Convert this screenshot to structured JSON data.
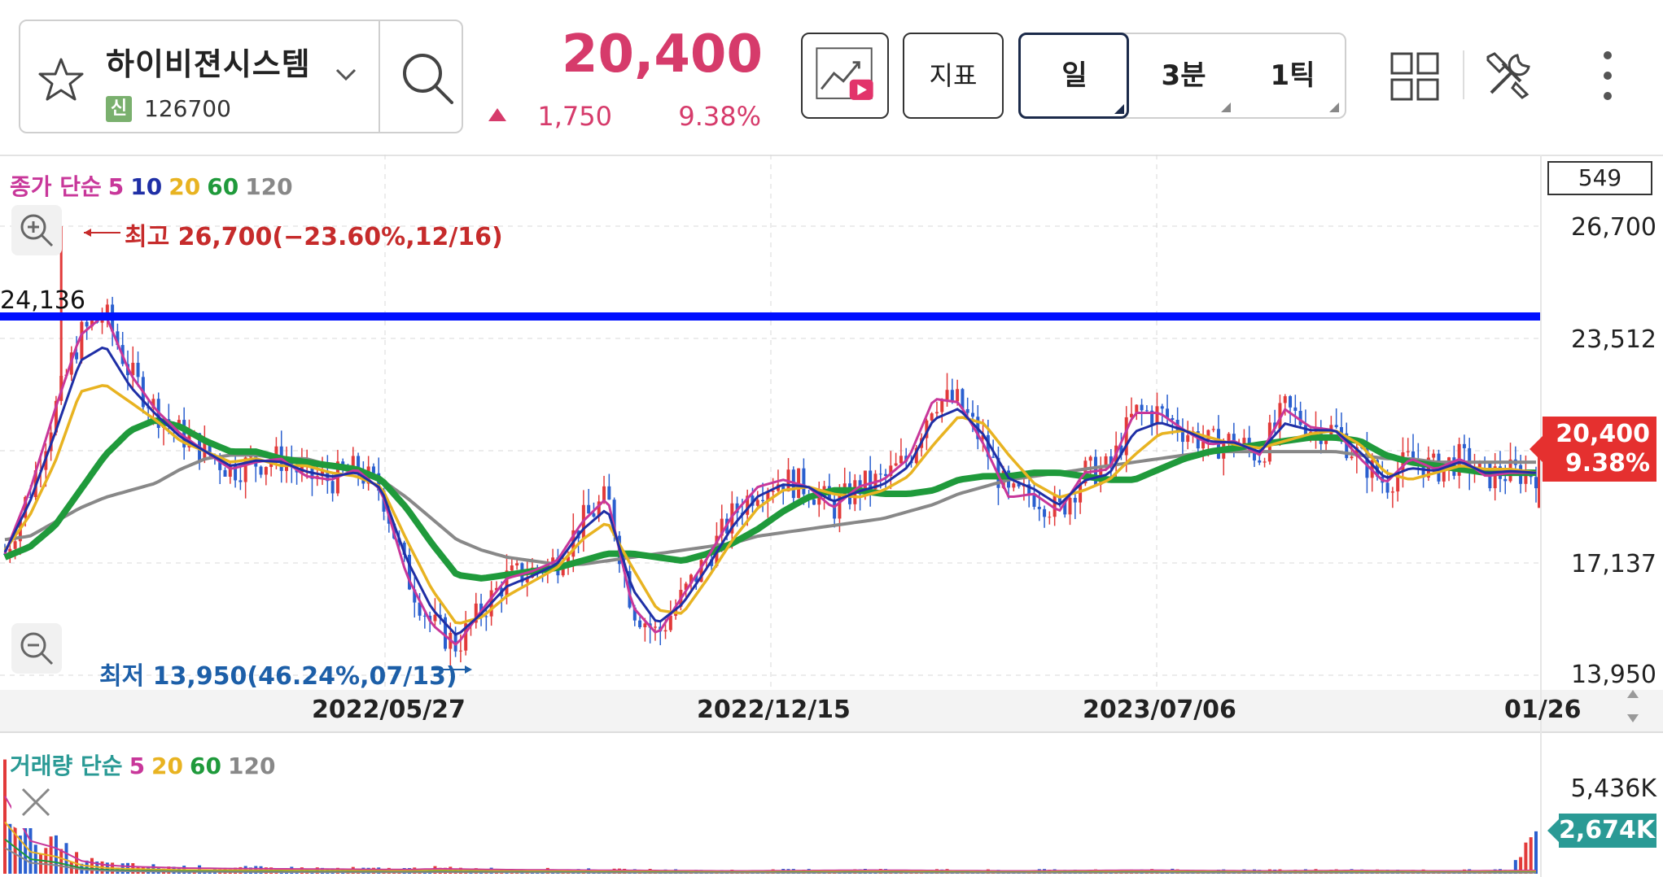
{
  "header": {
    "stock_name": "하이비젼시스템",
    "market_badge": "신",
    "stock_code": "126700",
    "price": "20,400",
    "change": "1,750",
    "change_pct": "9.38%",
    "indicator_button": "지표",
    "periods": [
      "일",
      "3분",
      "1틱"
    ],
    "selected_period": "일",
    "icons": [
      "star-icon",
      "chevron-down-icon",
      "search-icon",
      "chart-video-icon",
      "grid-layout-icon",
      "tools-icon",
      "more-vertical-icon"
    ],
    "colors": {
      "up": "#d63b6b"
    }
  },
  "price_panel": {
    "legend_prefix": "종가 단순",
    "ma_periods": [
      "5",
      "10",
      "20",
      "60",
      "120"
    ],
    "ma_colors": [
      "#c8379a",
      "#1f2fa6",
      "#e8b321",
      "#1f9a3b",
      "#888888"
    ],
    "count_badge": "549",
    "high_annotation": "최고 26,700(−23.60%,12/16)",
    "low_annotation": "최저 13,950(46.24%,07/13)",
    "hline_label": "24,136",
    "hline_color": "#0010ff",
    "current_price": "20,400",
    "current_pct": "9.38%"
  },
  "volume_panel": {
    "legend_prefix": "거래량 단순",
    "ma_periods": [
      "5",
      "20",
      "60",
      "120"
    ],
    "ma_colors": [
      "#c8379a",
      "#e8b321",
      "#1f9a3b",
      "#888888"
    ],
    "axis_top": "5,436K",
    "current_volume": "2,674K"
  },
  "chart_data": {
    "type": "candlestick",
    "price_axis_ticks": [
      "26,700",
      "23,512",
      "20,400",
      "17,137",
      "13,950"
    ],
    "ylim": [
      13950,
      26700
    ],
    "x_ticks": [
      "2022/05/27",
      "2022/12/15",
      "2023/07/06",
      "01/26"
    ],
    "horizontal_line": 24136,
    "high": {
      "value": 26700,
      "date": "12/16"
    },
    "low": {
      "value": 13950,
      "date": "07/13"
    },
    "series": [
      {
        "name": "5",
        "values": [
          17400,
          19200,
          21500,
          23600,
          24200,
          22500,
          21500,
          20800,
          20300,
          19800,
          20000,
          20100,
          19600,
          19500,
          19800,
          19200,
          16800,
          15400,
          14800,
          15800,
          16700,
          16900,
          17200,
          18300,
          19000,
          15900,
          15100,
          16200,
          17300,
          18500,
          19300,
          19500,
          19300,
          18700,
          19300,
          19500,
          20100,
          21800,
          21700,
          20500,
          19000,
          19100,
          18600,
          19700,
          19800,
          21400,
          21400,
          20900,
          20500,
          20600,
          20200,
          21500,
          21000,
          20900,
          20100,
          19400,
          20100,
          19800,
          20100,
          19600,
          19700,
          19700
        ]
      },
      {
        "name": "20",
        "values": [
          17500,
          18500,
          20000,
          22000,
          22200,
          21700,
          21200,
          20600,
          20300,
          20000,
          20100,
          19900,
          19900,
          19700,
          19600,
          19300,
          17800,
          16400,
          15400,
          15600,
          16200,
          16600,
          17000,
          17800,
          18300,
          17000,
          15800,
          15700,
          16700,
          17800,
          18700,
          19200,
          19300,
          19100,
          19000,
          19200,
          19600,
          20500,
          21300,
          21100,
          20200,
          19400,
          19000,
          19200,
          19500,
          20200,
          20800,
          20900,
          20700,
          20500,
          20400,
          20600,
          20800,
          20900,
          20500,
          19700,
          19500,
          19700,
          19900,
          19800,
          19800,
          19700
        ]
      },
      {
        "name": "60",
        "values": [
          17300,
          17600,
          18200,
          19200,
          20200,
          20900,
          21200,
          21000,
          20600,
          20300,
          20300,
          20100,
          20000,
          19900,
          19800,
          19500,
          18700,
          17700,
          16800,
          16700,
          16800,
          16900,
          17000,
          17200,
          17400,
          17400,
          17300,
          17200,
          17400,
          17700,
          18100,
          18600,
          19000,
          19200,
          19200,
          19100,
          19100,
          19200,
          19500,
          19600,
          19600,
          19700,
          19700,
          19600,
          19500,
          19500,
          19800,
          20100,
          20300,
          20400,
          20500,
          20600,
          20700,
          20700,
          20600,
          20200,
          20000,
          19900,
          19800,
          19700,
          19700,
          19700
        ]
      },
      {
        "name": "120",
        "values": [
          17800,
          17900,
          18300,
          18700,
          19000,
          19200,
          19400,
          19800,
          20100,
          20200,
          20200,
          20100,
          20100,
          19900,
          19700,
          19500,
          19000,
          18400,
          17800,
          17500,
          17300,
          17200,
          17100,
          17100,
          17200,
          17300,
          17400,
          17500,
          17600,
          17700,
          17900,
          18000,
          18100,
          18200,
          18300,
          18400,
          18600,
          18800,
          19100,
          19300,
          19500,
          19600,
          19700,
          19800,
          19900,
          20000,
          20100,
          20200,
          20300,
          20300,
          20300,
          20300,
          20300,
          20300,
          20200,
          20100,
          20100,
          20000,
          20000,
          20000,
          20000,
          20000
        ]
      }
    ],
    "last_close": 20400,
    "volume_axis_ticks": [
      "5,436K",
      "2,674K"
    ],
    "volume_series": [
      5436,
      2300,
      1800,
      900,
      600,
      500,
      450,
      400,
      380,
      360,
      350,
      340,
      330,
      320,
      310,
      300,
      300,
      350,
      320,
      300,
      280,
      270,
      260,
      250,
      240,
      230,
      220,
      210,
      200,
      200,
      210,
      220,
      230,
      240,
      250,
      240,
      230,
      220,
      210,
      200,
      200,
      210,
      220,
      230,
      240,
      240,
      230,
      220,
      210,
      200,
      200,
      210,
      220,
      230,
      220,
      210,
      200,
      200,
      210,
      220,
      230,
      2674
    ]
  }
}
